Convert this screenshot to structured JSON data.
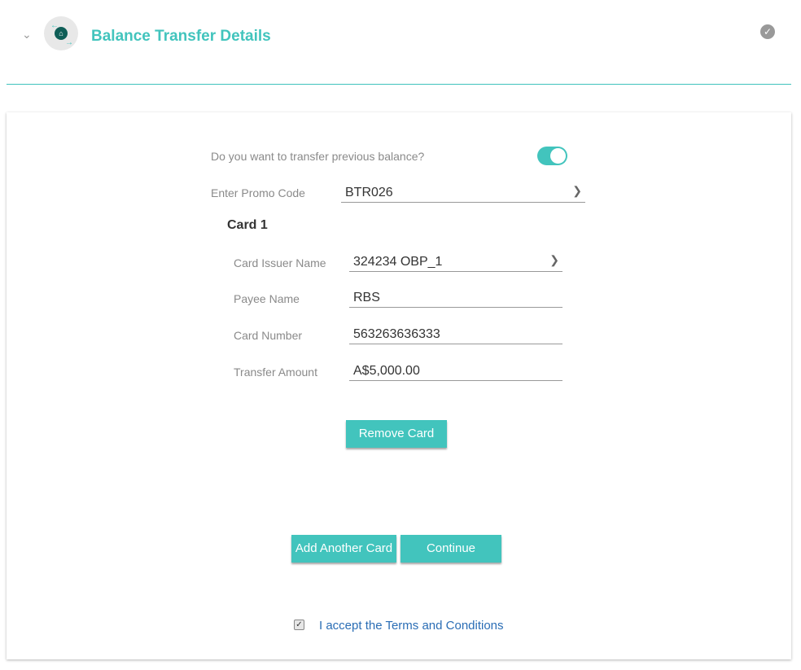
{
  "header": {
    "title": "Balance Transfer Details"
  },
  "form": {
    "transfer_question": "Do you want to transfer previous balance?",
    "transfer_enabled": true,
    "promo_label": "Enter Promo Code",
    "promo_value": "BTR026",
    "card_title": "Card 1",
    "issuer_label": "Card Issuer Name",
    "issuer_value": "324234 OBP_1",
    "payee_label": "Payee Name",
    "payee_value": "RBS",
    "number_label": "Card Number",
    "number_value": "563263636333",
    "amount_label": "Transfer Amount",
    "amount_value": "A$5,000.00",
    "remove_label": "Remove Card",
    "add_label": "Add Another Card",
    "continue_label": "Continue",
    "terms_label": "I accept the Terms and Conditions",
    "terms_checked": true
  },
  "colors": {
    "accent": "#42c4bd",
    "link": "#2a6db5"
  }
}
